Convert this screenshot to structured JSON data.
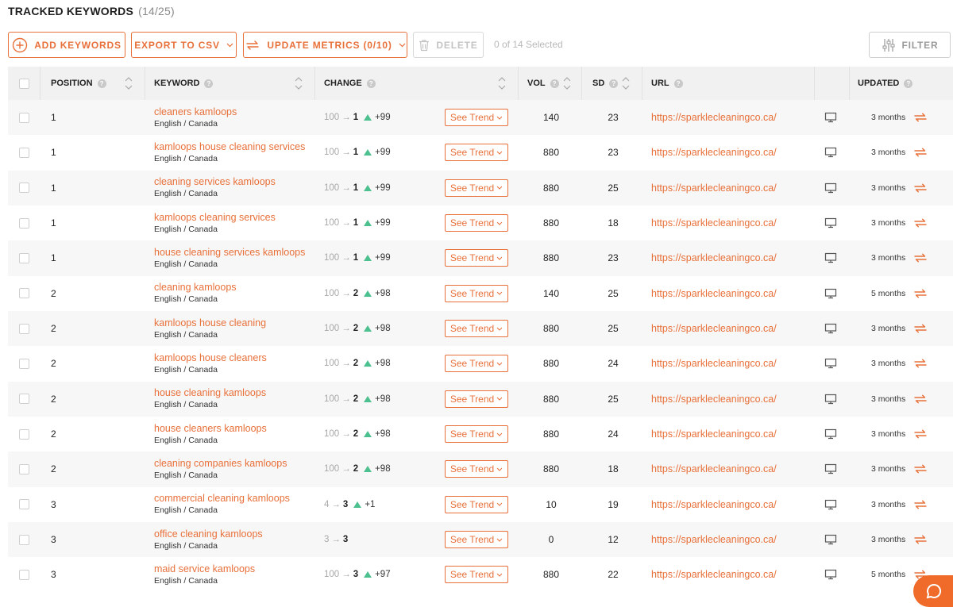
{
  "header": {
    "title": "TRACKED KEYWORDS",
    "count": "(14/25)"
  },
  "toolbar": {
    "add_keywords": "ADD KEYWORDS",
    "export_csv": "EXPORT TO CSV",
    "update_metrics": "UPDATE METRICS (0/10)",
    "delete": "DELETE",
    "selected": "0 of 14 Selected",
    "filter": "FILTER"
  },
  "columns": {
    "position": "POSITION",
    "keyword": "KEYWORD",
    "change": "CHANGE",
    "vol": "VOL",
    "sd": "SD",
    "url": "URL",
    "updated": "UPDATED"
  },
  "trend_label": "See Trend",
  "rows": [
    {
      "position": "1",
      "keyword": "cleaners kamloops",
      "locale": "English / Canada",
      "from": "100",
      "to": "1",
      "delta": "+99",
      "vol": "140",
      "sd": "23",
      "url": "https://sparklecleaningco.ca/",
      "updated": "3 months"
    },
    {
      "position": "1",
      "keyword": "kamloops house cleaning services",
      "locale": "English / Canada",
      "from": "100",
      "to": "1",
      "delta": "+99",
      "vol": "880",
      "sd": "23",
      "url": "https://sparklecleaningco.ca/",
      "updated": "3 months"
    },
    {
      "position": "1",
      "keyword": "cleaning services kamloops",
      "locale": "English / Canada",
      "from": "100",
      "to": "1",
      "delta": "+99",
      "vol": "880",
      "sd": "25",
      "url": "https://sparklecleaningco.ca/",
      "updated": "3 months"
    },
    {
      "position": "1",
      "keyword": "kamloops cleaning services",
      "locale": "English / Canada",
      "from": "100",
      "to": "1",
      "delta": "+99",
      "vol": "880",
      "sd": "18",
      "url": "https://sparklecleaningco.ca/",
      "updated": "3 months"
    },
    {
      "position": "1",
      "keyword": "house cleaning services kamloops",
      "locale": "English / Canada",
      "from": "100",
      "to": "1",
      "delta": "+99",
      "vol": "880",
      "sd": "23",
      "url": "https://sparklecleaningco.ca/",
      "updated": "3 months"
    },
    {
      "position": "2",
      "keyword": "cleaning kamloops",
      "locale": "English / Canada",
      "from": "100",
      "to": "2",
      "delta": "+98",
      "vol": "140",
      "sd": "25",
      "url": "https://sparklecleaningco.ca/",
      "updated": "5 months"
    },
    {
      "position": "2",
      "keyword": "kamloops house cleaning",
      "locale": "English / Canada",
      "from": "100",
      "to": "2",
      "delta": "+98",
      "vol": "880",
      "sd": "25",
      "url": "https://sparklecleaningco.ca/",
      "updated": "3 months"
    },
    {
      "position": "2",
      "keyword": "kamloops house cleaners",
      "locale": "English / Canada",
      "from": "100",
      "to": "2",
      "delta": "+98",
      "vol": "880",
      "sd": "24",
      "url": "https://sparklecleaningco.ca/",
      "updated": "3 months"
    },
    {
      "position": "2",
      "keyword": "house cleaning kamloops",
      "locale": "English / Canada",
      "from": "100",
      "to": "2",
      "delta": "+98",
      "vol": "880",
      "sd": "25",
      "url": "https://sparklecleaningco.ca/",
      "updated": "3 months"
    },
    {
      "position": "2",
      "keyword": "house cleaners kamloops",
      "locale": "English / Canada",
      "from": "100",
      "to": "2",
      "delta": "+98",
      "vol": "880",
      "sd": "24",
      "url": "https://sparklecleaningco.ca/",
      "updated": "3 months"
    },
    {
      "position": "2",
      "keyword": "cleaning companies kamloops",
      "locale": "English / Canada",
      "from": "100",
      "to": "2",
      "delta": "+98",
      "vol": "880",
      "sd": "18",
      "url": "https://sparklecleaningco.ca/",
      "updated": "3 months"
    },
    {
      "position": "3",
      "keyword": "commercial cleaning kamloops",
      "locale": "English / Canada",
      "from": "4",
      "to": "3",
      "delta": "+1",
      "vol": "10",
      "sd": "19",
      "url": "https://sparklecleaningco.ca/",
      "updated": "3 months"
    },
    {
      "position": "3",
      "keyword": "office cleaning kamloops",
      "locale": "English / Canada",
      "from": "3",
      "to": "3",
      "delta": "",
      "vol": "0",
      "sd": "12",
      "url": "https://sparklecleaningco.ca/",
      "updated": "3 months"
    },
    {
      "position": "3",
      "keyword": "maid service kamloops",
      "locale": "English / Canada",
      "from": "100",
      "to": "3",
      "delta": "+97",
      "vol": "880",
      "sd": "22",
      "url": "https://sparklecleaningco.ca/",
      "updated": "5 months"
    }
  ]
}
